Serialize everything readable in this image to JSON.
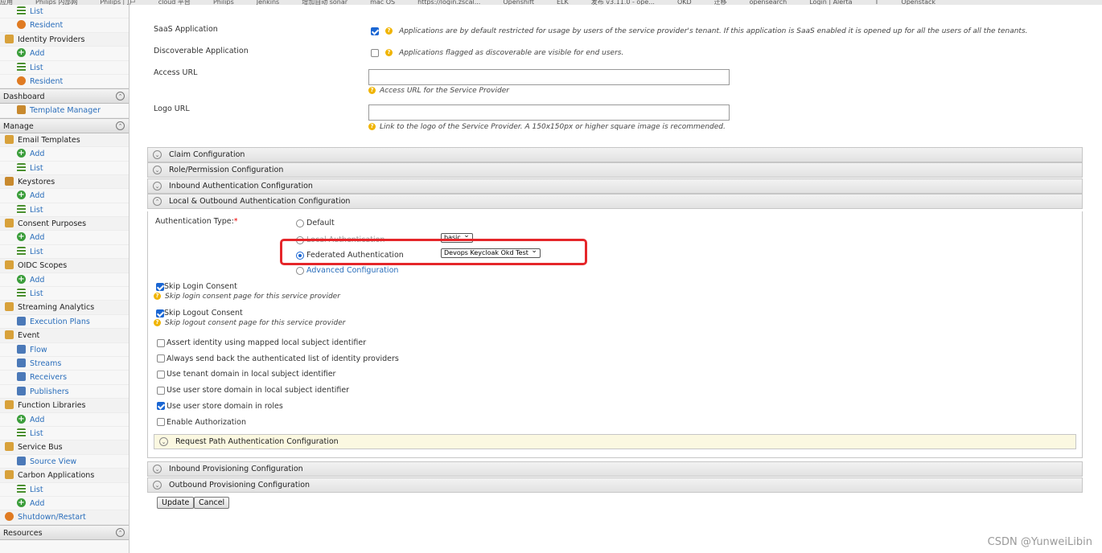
{
  "bookmarks": [
    "应用",
    "Philips 内部网",
    "Philips 门户",
    "cloud 平台",
    "Philips",
    "Jenkins",
    "增加自动 sonar",
    "mac OS",
    "https://login.zscal...",
    "Openshift",
    "ELK",
    "发布 v3.11.0 - ope...",
    "OKD",
    "迁移",
    "opensearch",
    "Login | Alerta",
    "T",
    "Openstack"
  ],
  "sidebar": {
    "items": [
      {
        "label": "List",
        "icon": "list-icon",
        "level": 1
      },
      {
        "label": "Resident",
        "icon": "resident-icon",
        "level": 1
      },
      {
        "label": "Identity Providers",
        "icon": "identity-providers-icon",
        "level": 0
      },
      {
        "label": "Add",
        "icon": "add-icon",
        "level": 1
      },
      {
        "label": "List",
        "icon": "list-icon",
        "level": 1
      },
      {
        "label": "Resident",
        "icon": "resident-icon",
        "level": 1
      }
    ],
    "dashboard_title": "Dashboard",
    "dashboard_items": [
      {
        "label": "Template Manager",
        "icon": "template-icon",
        "level": 1
      }
    ],
    "manage_title": "Manage",
    "manage_items": [
      {
        "label": "Email Templates",
        "icon": "email-icon",
        "level": 0
      },
      {
        "label": "Add",
        "icon": "add-icon",
        "level": 1
      },
      {
        "label": "List",
        "icon": "edit-list-icon",
        "level": 1
      },
      {
        "label": "Keystores",
        "icon": "key-icon",
        "level": 0
      },
      {
        "label": "Add",
        "icon": "add-icon",
        "level": 1
      },
      {
        "label": "List",
        "icon": "list-icon",
        "level": 1
      },
      {
        "label": "Consent Purposes",
        "icon": "consent-icon",
        "level": 0
      },
      {
        "label": "Add",
        "icon": "add-icon",
        "level": 1
      },
      {
        "label": "List",
        "icon": "list-icon",
        "level": 1
      },
      {
        "label": "OIDC Scopes",
        "icon": "oidc-icon",
        "level": 0
      },
      {
        "label": "Add",
        "icon": "add-icon",
        "level": 1
      },
      {
        "label": "List",
        "icon": "list-icon",
        "level": 1
      },
      {
        "label": "Streaming Analytics",
        "icon": "analytics-icon",
        "level": 0
      },
      {
        "label": "Execution Plans",
        "icon": "execution-icon",
        "level": 1
      },
      {
        "label": "Event",
        "icon": "event-icon",
        "level": 0
      },
      {
        "label": "Flow",
        "icon": "flow-icon",
        "level": 1
      },
      {
        "label": "Streams",
        "icon": "streams-icon",
        "level": 1
      },
      {
        "label": "Receivers",
        "icon": "receivers-icon",
        "level": 1
      },
      {
        "label": "Publishers",
        "icon": "publishers-icon",
        "level": 1
      },
      {
        "label": "Function Libraries",
        "icon": "function-icon",
        "level": 0
      },
      {
        "label": "Add",
        "icon": "add-icon",
        "level": 1
      },
      {
        "label": "List",
        "icon": "list-icon",
        "level": 1
      },
      {
        "label": "Service Bus",
        "icon": "service-bus-icon",
        "level": 0
      },
      {
        "label": "Source View",
        "icon": "source-icon",
        "level": 1
      },
      {
        "label": "Carbon Applications",
        "icon": "carbon-icon",
        "level": 0
      },
      {
        "label": "List",
        "icon": "list-icon",
        "level": 1
      },
      {
        "label": "Add",
        "icon": "add-icon",
        "level": 1
      },
      {
        "label": "Shutdown/Restart",
        "icon": "shutdown-icon",
        "level": 0
      }
    ],
    "resources_title": "Resources"
  },
  "form": {
    "saas_label": "SaaS Application",
    "saas_hint": "Applications are by default restricted for usage by users of the service provider's tenant. If this application is SaaS enabled it is opened up for all the users of all the tenants.",
    "discoverable_label": "Discoverable Application",
    "discoverable_hint": "Applications flagged as discoverable are visible for end users.",
    "access_url_label": "Access URL",
    "access_url_value": "",
    "access_url_hint": "Access URL for the Service Provider",
    "logo_url_label": "Logo URL",
    "logo_url_value": "",
    "logo_url_hint": "Link to the logo of the Service Provider. A 150x150px or higher square image is recommended."
  },
  "sections": {
    "claim": "Claim Configuration",
    "role": "Role/Permission Configuration",
    "inbound_auth": "Inbound Authentication Configuration",
    "local_outbound": "Local & Outbound Authentication Configuration",
    "request_path": "Request Path Authentication Configuration",
    "inbound_prov": "Inbound Provisioning Configuration",
    "outbound_prov": "Outbound Provisioning Configuration"
  },
  "auth": {
    "type_label": "Authentication Type:",
    "required_mark": "*",
    "opt_default": "Default",
    "opt_local": "Local Authentication",
    "local_select": "basic",
    "opt_federated": "Federated Authentication",
    "federated_select": "Devops Keycloak Okd Test",
    "opt_advanced": "Advanced Configuration",
    "selected": "federated"
  },
  "consent": {
    "skip_login": "Skip Login Consent",
    "skip_login_hint": "Skip login consent page for this service provider",
    "skip_logout": "Skip Logout Consent",
    "skip_logout_hint": "Skip logout consent page for this service provider"
  },
  "options": [
    {
      "label": "Assert identity using mapped local subject identifier",
      "checked": false
    },
    {
      "label": "Always send back the authenticated list of identity providers",
      "checked": false
    },
    {
      "label": "Use tenant domain in local subject identifier",
      "checked": false
    },
    {
      "label": "Use user store domain in local subject identifier",
      "checked": false
    },
    {
      "label": "Use user store domain in roles",
      "checked": true
    },
    {
      "label": "Enable Authorization",
      "checked": false
    }
  ],
  "buttons": {
    "update": "Update",
    "cancel": "Cancel"
  },
  "watermark": "CSDN @YunweiLibin",
  "colors": {
    "accent": "#1a66d3",
    "link": "#2a6ebb",
    "highlight_box": "#e5262a",
    "request_path_bar": "#fbf8e1"
  }
}
